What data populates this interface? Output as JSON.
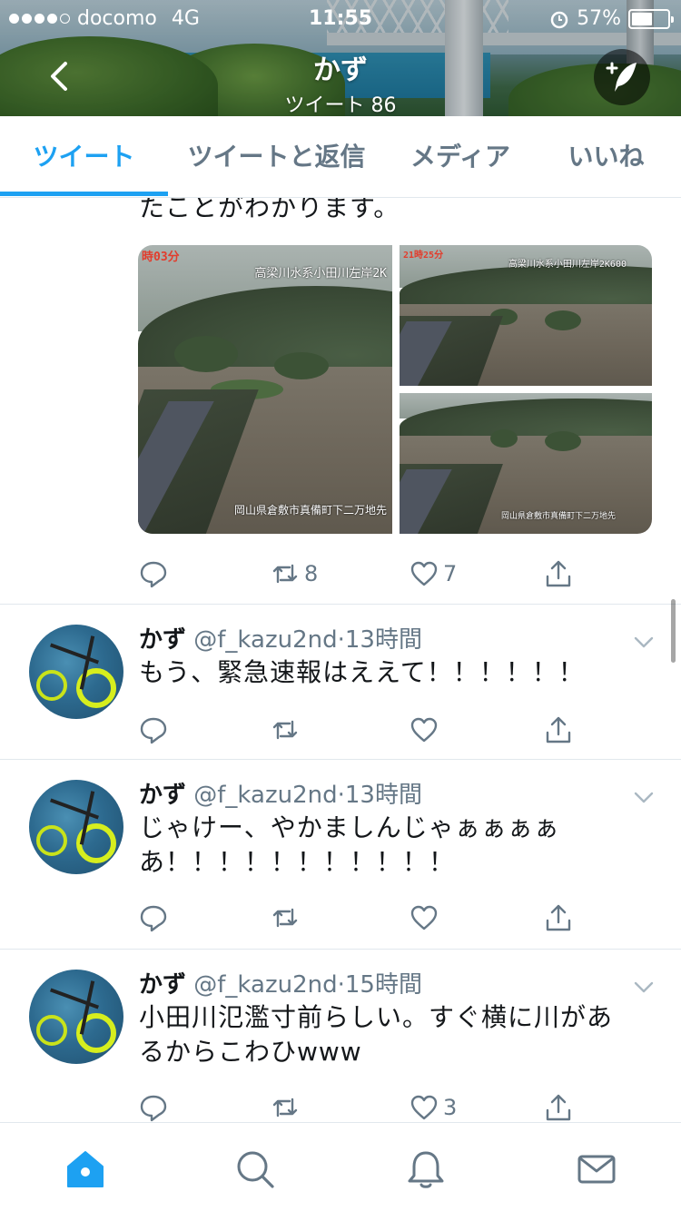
{
  "statusbar": {
    "carrier": "docomo",
    "network": "4G",
    "time": "11:55",
    "battery": "57%",
    "battery_level": 0.57,
    "signal_bars": 4
  },
  "header": {
    "name": "かず",
    "tweet_count": "ツイート 86"
  },
  "tabs": [
    {
      "label": "ツイート",
      "active": true
    },
    {
      "label": "ツイートと返信",
      "active": false
    },
    {
      "label": "メディア",
      "active": false
    },
    {
      "label": "いいね",
      "active": false
    }
  ],
  "top_tweet": {
    "text_fragment": "たことがわかります。",
    "media": [
      {
        "time_label": "時03分",
        "title_label": "高梁川水系小田川左岸2K",
        "location_label": "岡山県倉敷市真備町下二万地先"
      },
      {
        "time_label": "21時25分",
        "title_label": "高梁川水系小田川左岸2K600"
      },
      {
        "location_label": "岡山県倉敷市真備町下二万地先"
      }
    ],
    "retweets": "8",
    "likes": "7"
  },
  "tweets": [
    {
      "name": "かず",
      "handle": "@f_kazu2nd",
      "time": "13時間",
      "text": "もう、緊急速報はええて！！！！！！",
      "retweets": "",
      "likes": ""
    },
    {
      "name": "かず",
      "handle": "@f_kazu2nd",
      "time": "13時間",
      "text": "じゃけー、やかましんじゃぁぁぁぁあ！！！！！！！！！！！",
      "retweets": "",
      "likes": ""
    },
    {
      "name": "かず",
      "handle": "@f_kazu2nd",
      "time": "15時間",
      "text": "小田川氾濫寸前らしい。すぐ横に川があるからこわひwww",
      "retweets": "",
      "likes": "3"
    }
  ],
  "colors": {
    "accent": "#1da1f2",
    "text": "#14171a",
    "secondary": "#657786",
    "divider": "#e1e8ed"
  },
  "bottom_nav": [
    {
      "icon": "home-icon",
      "active": true
    },
    {
      "icon": "search-icon",
      "active": false
    },
    {
      "icon": "notifications-icon",
      "active": false
    },
    {
      "icon": "messages-icon",
      "active": false
    }
  ]
}
